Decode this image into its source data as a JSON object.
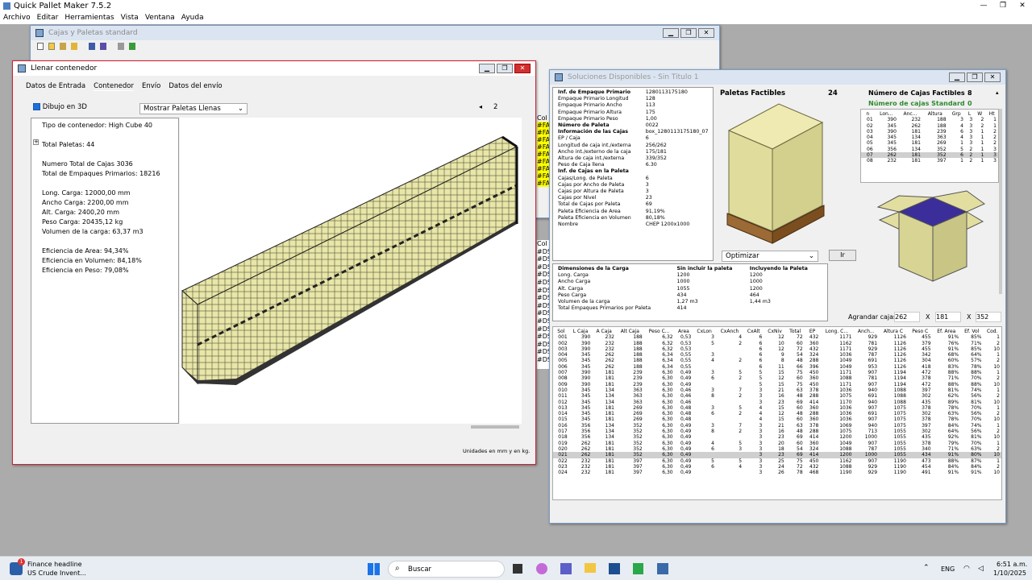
{
  "app": {
    "title": "Quick Pallet Maker 7.5.2",
    "menus": [
      "Archivo",
      "Editar",
      "Herramientas",
      "Vista",
      "Ventana",
      "Ayuda"
    ]
  },
  "cajas_win": {
    "title": "Cajas y Paletas standard",
    "col_labels": [
      "Col",
      "#FAF",
      "#FAF",
      "#FAF",
      "#FAF",
      "#FAF",
      "#FAF",
      "#FAF",
      "#FAF",
      "#FAF"
    ],
    "col2": [
      "Col",
      "#DS",
      "#DS",
      "#DS",
      "#DS",
      "#DS",
      "#DS",
      "#DS",
      "#DS",
      "#DS",
      "#DS",
      "#DS",
      "#DS",
      "#DS",
      "#DS",
      "#DS"
    ]
  },
  "llenar": {
    "title": "Llenar contenedor",
    "tabs": [
      "Datos de Entrada",
      "Contenedor",
      "Envío",
      "Datos del envío"
    ],
    "dibujo_label": "Dibujo en 3D",
    "mostrar": "Mostrar Paletas Llenas",
    "page": "2",
    "info": [
      "Tipo de contenedor: High Cube 40",
      "",
      "Total Paletas: 44",
      "",
      "Numero Total de Cajas 3036",
      "Total de Empaques Primarios: 18216",
      "",
      "Long. Carga: 12000,00 mm",
      "Ancho Carga: 2200,00 mm",
      "Alt. Carga: 2400,20 mm",
      "Peso Carga: 20435,12 kg",
      "Volumen de la carga: 63,37 m3",
      "",
      "Eficiencia de Area: 94,34%",
      "Eficiencia en Volumen: 84,18%",
      "Eficiencia en Peso: 79,08%"
    ],
    "units": "Unidades en mm y en kg."
  },
  "sol": {
    "title": "Soluciones Disponibles - Sin Titulo 1",
    "props": [
      [
        "Inf. de Empaque Primario",
        "1280113175180"
      ],
      [
        "Empaque Primario Longitud",
        "128"
      ],
      [
        "Empaque Primario Ancho",
        "113"
      ],
      [
        "Empaque Primario Altura",
        "175"
      ],
      [
        "Empaque Primario Peso",
        "1,00"
      ],
      [
        "",
        ""
      ],
      [
        "Número de Paleta",
        "0022"
      ],
      [
        "",
        ""
      ],
      [
        "Información de las Cajas",
        "box_1280113175180_07"
      ],
      [
        "EP / Caja",
        "6"
      ],
      [
        "Longitud de caja int./externa",
        "256/262"
      ],
      [
        "Ancho int./externo de la caja",
        "175/181"
      ],
      [
        "Altura de caja int./externa",
        "339/352"
      ],
      [
        "Peso de Caja llena",
        "6.30"
      ],
      [
        "",
        ""
      ],
      [
        "Inf. de Cajas en la Paleta",
        ""
      ],
      [
        "Cajas/Long. de Paleta",
        "6"
      ],
      [
        "Cajas por Ancho de Paleta",
        "3"
      ],
      [
        "Cajas por Altura de Paleta",
        "3"
      ],
      [
        "Cajas por Nivel",
        "23"
      ],
      [
        "Total de Cajas por Paleta",
        "69"
      ],
      [
        "",
        ""
      ],
      [
        "Paleta Eficiencia de Area",
        "91,19%"
      ],
      [
        "Paleta Eficiencia en Volumen",
        "80,18%"
      ],
      [
        "",
        ""
      ],
      [
        "Nombre",
        "CHEP 1200x1000"
      ]
    ],
    "paletas_label": "Paletas Factibles",
    "paletas_val": "24",
    "num_label": "Número de Cajas Factibles",
    "num_val": "8",
    "std_label": "Número de cajas Standard",
    "std_val": "0",
    "small_head": [
      "n",
      "Lon...",
      "Anc...",
      "Altura",
      "Grp",
      "L",
      "W",
      "Ht"
    ],
    "small_rows": [
      [
        "01",
        "390",
        "232",
        "188",
        "3",
        "3",
        "2",
        "1"
      ],
      [
        "02",
        "345",
        "262",
        "188",
        "4",
        "3",
        "2",
        "1"
      ],
      [
        "03",
        "390",
        "181",
        "239",
        "6",
        "3",
        "1",
        "2"
      ],
      [
        "04",
        "345",
        "134",
        "363",
        "4",
        "3",
        "1",
        "2"
      ],
      [
        "05",
        "345",
        "181",
        "269",
        "1",
        "3",
        "1",
        "2"
      ],
      [
        "06",
        "356",
        "134",
        "352",
        "5",
        "2",
        "1",
        "3"
      ],
      [
        "07",
        "262",
        "181",
        "352",
        "6",
        "2",
        "1",
        "3"
      ],
      [
        "08",
        "232",
        "181",
        "397",
        "1",
        "2",
        "1",
        "3"
      ]
    ],
    "optimizar": "Optimizar",
    "ir": "Ir",
    "dims": {
      "head": [
        "Dimensiones de la Carga",
        "Sin incluir la paleta",
        "Incluyendo la Paleta"
      ],
      "rows": [
        [
          "Long. Carga",
          "1200",
          "1200"
        ],
        [
          "Ancho Carga",
          "1000",
          "1000"
        ],
        [
          "Alt. Carga",
          "1055",
          "1200"
        ],
        [
          "Peso Carga",
          "434",
          "464"
        ],
        [
          "Volumen de la carga",
          "1,27 m3",
          "1,44 m3"
        ],
        [
          "",
          "",
          " "
        ],
        [
          "Total Empaques Primarios por Paleta",
          "414",
          ""
        ]
      ]
    },
    "agrandar": {
      "label": "Agrandar cajas",
      "v1": "262",
      "x1": "X",
      "v2": "181",
      "x2": "X",
      "v3": "352"
    },
    "grid_head": [
      "Sol",
      "L Caja",
      "A Caja",
      "Alt Caja",
      "Peso C...",
      "Area",
      "CxLon",
      "CxAnch",
      "CxAlt",
      "CxNiv",
      "Total",
      "EP",
      "Long. C...",
      "Anch...",
      "Altura C",
      "Peso C",
      "Ef. Area",
      "Ef. Vol",
      "Cod."
    ],
    "grid_rows": [
      [
        "001",
        "390",
        "232",
        "188",
        "6,32",
        "0,53",
        "3",
        "4",
        "6",
        "12",
        "72",
        "432",
        "1171",
        "929",
        "1126",
        "455",
        "91%",
        "85%",
        "1"
      ],
      [
        "002",
        "390",
        "232",
        "188",
        "6,32",
        "0,53",
        "5",
        "2",
        "6",
        "10",
        "60",
        "360",
        "1162",
        "781",
        "1126",
        "379",
        "76%",
        "71%",
        "2"
      ],
      [
        "003",
        "390",
        "232",
        "188",
        "6,32",
        "0,53",
        "",
        "",
        "6",
        "12",
        "72",
        "432",
        "1171",
        "929",
        "1126",
        "455",
        "91%",
        "85%",
        "10"
      ],
      [
        "004",
        "345",
        "262",
        "188",
        "6,34",
        "0,55",
        "3",
        "",
        "6",
        "9",
        "54",
        "324",
        "1036",
        "787",
        "1126",
        "342",
        "68%",
        "64%",
        "1"
      ],
      [
        "005",
        "345",
        "262",
        "188",
        "6,34",
        "0,55",
        "4",
        "2",
        "6",
        "8",
        "48",
        "288",
        "1049",
        "691",
        "1126",
        "304",
        "60%",
        "57%",
        "2"
      ],
      [
        "006",
        "345",
        "262",
        "188",
        "6,34",
        "0,55",
        "",
        "",
        "6",
        "11",
        "66",
        "396",
        "1049",
        "953",
        "1126",
        "418",
        "83%",
        "78%",
        "10"
      ],
      [
        "007",
        "390",
        "181",
        "239",
        "6,30",
        "0,49",
        "3",
        "5",
        "5",
        "15",
        "75",
        "450",
        "1171",
        "907",
        "1194",
        "472",
        "88%",
        "88%",
        "1"
      ],
      [
        "008",
        "390",
        "181",
        "239",
        "6,30",
        "0,49",
        "6",
        "2",
        "5",
        "12",
        "60",
        "360",
        "1088",
        "781",
        "1194",
        "378",
        "71%",
        "70%",
        "2"
      ],
      [
        "009",
        "390",
        "181",
        "239",
        "6,30",
        "0,49",
        "",
        "",
        "5",
        "15",
        "75",
        "450",
        "1171",
        "907",
        "1194",
        "472",
        "88%",
        "88%",
        "10"
      ],
      [
        "010",
        "345",
        "134",
        "363",
        "6,30",
        "0,46",
        "3",
        "7",
        "3",
        "21",
        "63",
        "378",
        "1036",
        "940",
        "1088",
        "397",
        "81%",
        "74%",
        "1"
      ],
      [
        "011",
        "345",
        "134",
        "363",
        "6,30",
        "0,46",
        "8",
        "2",
        "3",
        "16",
        "48",
        "288",
        "1075",
        "691",
        "1088",
        "302",
        "62%",
        "56%",
        "2"
      ],
      [
        "012",
        "345",
        "134",
        "363",
        "6,30",
        "0,46",
        "",
        "",
        "3",
        "23",
        "69",
        "414",
        "1170",
        "940",
        "1088",
        "435",
        "89%",
        "81%",
        "10"
      ],
      [
        "013",
        "345",
        "181",
        "269",
        "6,30",
        "0,48",
        "3",
        "5",
        "4",
        "15",
        "60",
        "360",
        "1036",
        "907",
        "1075",
        "378",
        "78%",
        "70%",
        "1"
      ],
      [
        "014",
        "345",
        "181",
        "269",
        "6,30",
        "0,48",
        "6",
        "2",
        "4",
        "12",
        "48",
        "288",
        "1036",
        "691",
        "1075",
        "302",
        "63%",
        "56%",
        "2"
      ],
      [
        "015",
        "345",
        "181",
        "269",
        "6,30",
        "0,48",
        "",
        "",
        "4",
        "15",
        "60",
        "360",
        "1036",
        "907",
        "1075",
        "378",
        "78%",
        "70%",
        "10"
      ],
      [
        "016",
        "356",
        "134",
        "352",
        "6,30",
        "0,49",
        "3",
        "7",
        "3",
        "21",
        "63",
        "378",
        "1069",
        "940",
        "1075",
        "397",
        "84%",
        "74%",
        "1"
      ],
      [
        "017",
        "356",
        "134",
        "352",
        "6,30",
        "0,49",
        "8",
        "2",
        "3",
        "16",
        "48",
        "288",
        "1075",
        "713",
        "1055",
        "302",
        "64%",
        "56%",
        "2"
      ],
      [
        "018",
        "356",
        "134",
        "352",
        "6,30",
        "0,49",
        "",
        "",
        "3",
        "23",
        "69",
        "414",
        "1200",
        "1000",
        "1055",
        "435",
        "92%",
        "81%",
        "10"
      ],
      [
        "019",
        "262",
        "181",
        "352",
        "6,30",
        "0,49",
        "4",
        "5",
        "3",
        "20",
        "60",
        "360",
        "1049",
        "907",
        "1055",
        "378",
        "79%",
        "70%",
        "1"
      ],
      [
        "020",
        "262",
        "181",
        "352",
        "6,30",
        "0,49",
        "6",
        "3",
        "3",
        "18",
        "54",
        "324",
        "1088",
        "787",
        "1055",
        "340",
        "71%",
        "63%",
        "2"
      ],
      [
        "021",
        "262",
        "181",
        "352",
        "6,30",
        "0,49",
        "",
        "",
        "3",
        "23",
        "69",
        "414",
        "1200",
        "1000",
        "1055",
        "434",
        "91%",
        "80%",
        "10"
      ],
      [
        "022",
        "232",
        "181",
        "397",
        "6,30",
        "0,49",
        "5",
        "5",
        "3",
        "25",
        "75",
        "450",
        "1162",
        "907",
        "1190",
        "473",
        "88%",
        "87%",
        "1"
      ],
      [
        "023",
        "232",
        "181",
        "397",
        "6,30",
        "0,49",
        "6",
        "4",
        "3",
        "24",
        "72",
        "432",
        "1088",
        "929",
        "1190",
        "454",
        "84%",
        "84%",
        "2"
      ],
      [
        "024",
        "232",
        "181",
        "397",
        "6,30",
        "0,49",
        "",
        "",
        "3",
        "26",
        "78",
        "468",
        "1190",
        "929",
        "1190",
        "491",
        "91%",
        "91%",
        "10"
      ]
    ]
  },
  "taskbar": {
    "news_title": "Finance headline",
    "news_sub": "US Crude Invent...",
    "search": "Buscar",
    "lang": "ENG",
    "time": "6:51 a.m.",
    "date": "1/10/2025",
    "badge": "1"
  }
}
